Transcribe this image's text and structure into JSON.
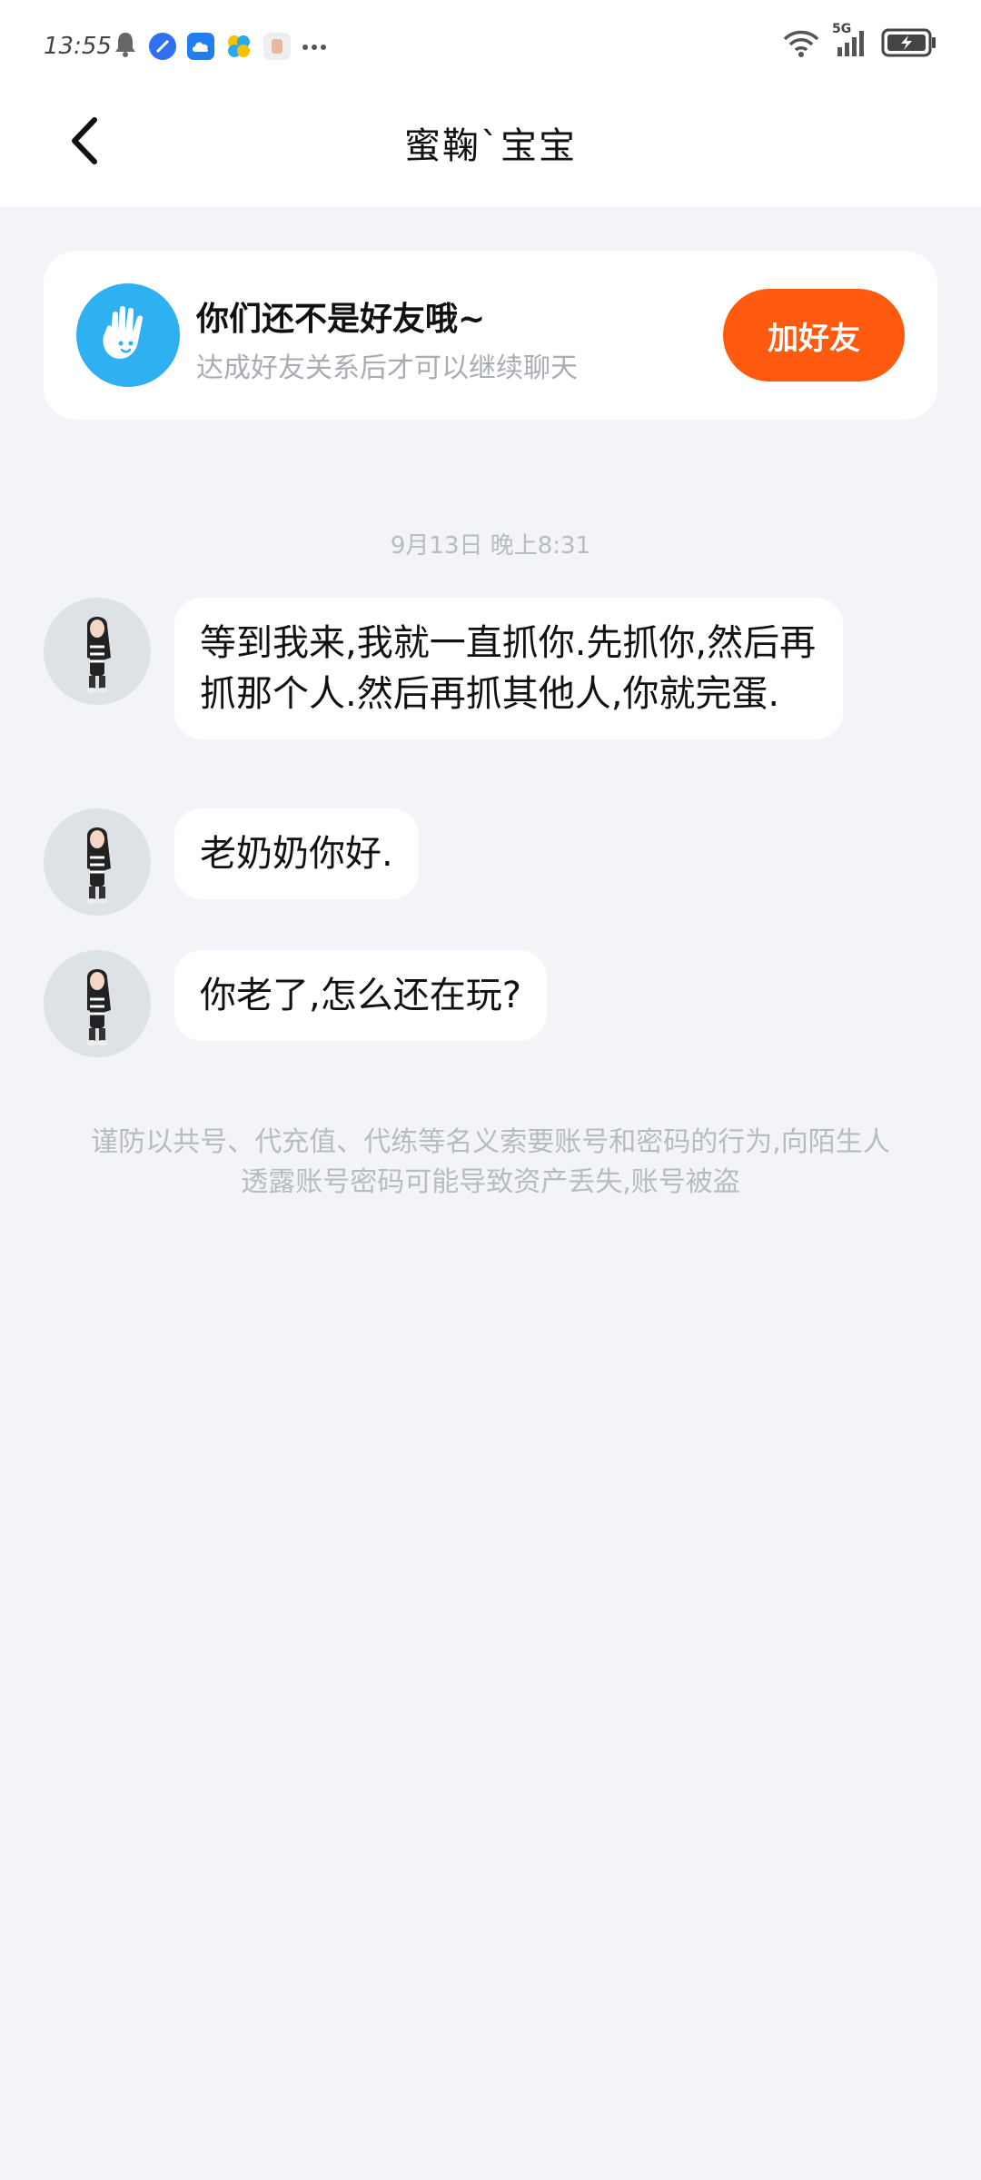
{
  "status_bar": {
    "time": "13:55",
    "network": "5G",
    "icons": [
      "bell-icon",
      "browser-icon",
      "cloud-icon",
      "pinwheel-icon",
      "app-icon",
      "more-dots-icon",
      "wifi-icon",
      "signal-icon",
      "battery-charging-icon"
    ]
  },
  "header": {
    "title": "蜜鞠`宝宝"
  },
  "friend_card": {
    "title": "你们还不是好友哦~",
    "subtitle": "达成好友关系后才可以继续聊天",
    "button_label": "加好友"
  },
  "chat": {
    "timestamp": "9月13日 晚上8:31",
    "messages": [
      {
        "text": "等到我来,我就一直抓你.先抓你,然后再抓那个人.然后再抓其他人,你就完蛋."
      },
      {
        "text": "老奶奶你好."
      },
      {
        "text": "你老了,怎么还在玩?"
      }
    ]
  },
  "notice": {
    "text": "谨防以共号、代充值、代练等名义索要账号和密码的行为,向陌生人透露账号密码可能导致资产丢失,账号被盗"
  },
  "colors": {
    "accent": "#ff5a0f",
    "badge": "#2fb0f0",
    "background": "#f2f4f7"
  }
}
